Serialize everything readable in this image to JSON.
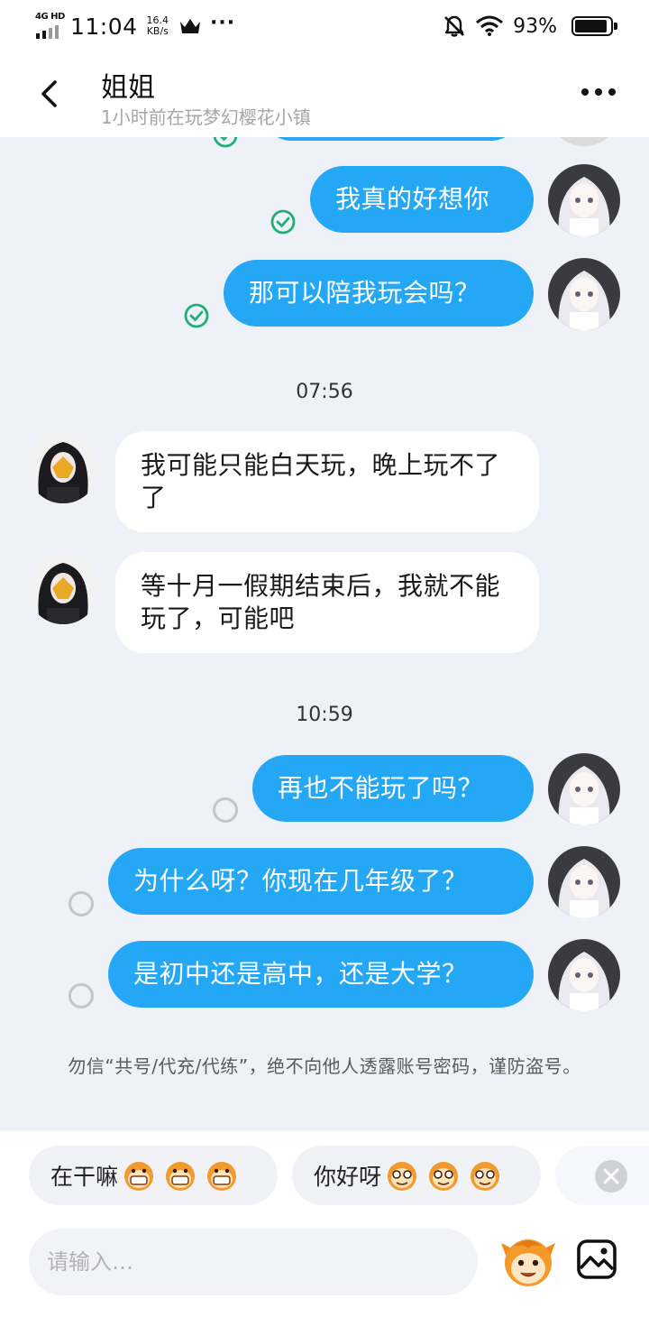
{
  "status_bar": {
    "network": "4G HD",
    "time": "11:04",
    "speed_value": "16.4",
    "speed_unit": "KB/s",
    "more": "···",
    "battery_percent": "93%",
    "battery_level": 0.93
  },
  "header": {
    "title": "姐姐",
    "subtitle": "1小时前在玩梦幻樱花小镇"
  },
  "messages": {
    "m1": "我真的好想你",
    "m2": "那可以陪我玩会吗？",
    "t1": "07:56",
    "m3": "我可能只能白天玩，晚上玩不了了",
    "m4": "等十月一假期结束后，我就不能玩了，可能吧",
    "t2": "10:59",
    "m5": "再也不能玩了吗？",
    "m6": "为什么呀？你现在几年级了？",
    "m7": "是初中还是高中，还是大学？"
  },
  "notice": "勿信“共号/代充/代练”，绝不向他人透露账号密码，谨防盗号。",
  "quick_replies": [
    {
      "label": "在干嘛",
      "emoji_icon": "grinning-monkey-icon"
    },
    {
      "label": "你好呀",
      "emoji_icon": "smiling-monkey-icon"
    }
  ],
  "input": {
    "placeholder": "请输入…",
    "value": ""
  },
  "colors": {
    "outgoing_bubble": "#24a8f5",
    "chat_background": "#eef1f8",
    "sent_check": "#1fae73"
  }
}
